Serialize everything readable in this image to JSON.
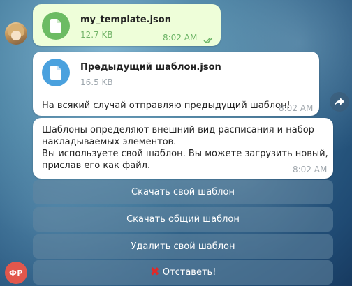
{
  "outgoing_file": {
    "name": "my_template.json",
    "size": "12.7 KB",
    "time": "8:02 AM",
    "icon": "document-icon",
    "status": "read-double-check"
  },
  "incoming_file": {
    "name": "Предыдущий шаблон.json",
    "size": "16.5 KB",
    "caption": "На всякий случай отправляю предыдущий шаблон!",
    "time": "8:02 AM",
    "icon": "document-icon"
  },
  "incoming_text": {
    "lines": [
      "Шаблоны определяют внешний вид расписания и набор",
      "накладываемых элементов.",
      "Вы используете свой шаблон. Вы можете загрузить новый,",
      "прислав его как файл."
    ],
    "time": "8:02 AM"
  },
  "keyboard": {
    "buttons": [
      "Скачать свой шаблон",
      "Скачать общий шаблон",
      "Удалить свой шаблон",
      "Отставеть!"
    ],
    "cancel_icon": "cross-mark-icon"
  },
  "bot_avatar_initials": "ФР",
  "colors": {
    "outgoing_bubble": "#eefed9",
    "incoming_bubble": "#ffffff",
    "green_icon": "#6cbb63",
    "blue_icon": "#4aa1de",
    "avatar_red": "#e2574c"
  }
}
